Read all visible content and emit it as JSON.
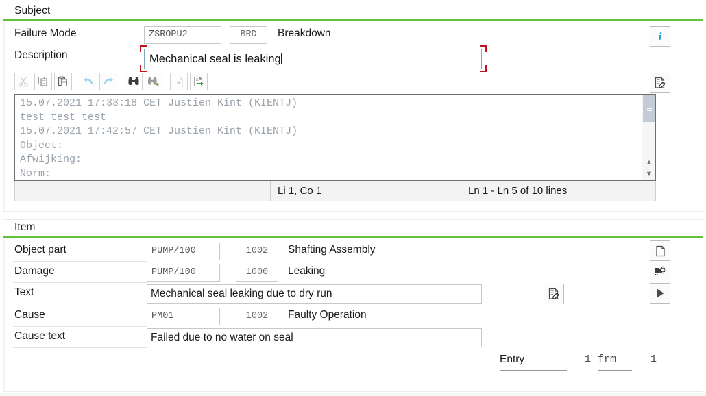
{
  "subject_section": {
    "title": "Subject",
    "failure_mode": {
      "label": "Failure Mode",
      "code": "ZSROPU2",
      "short_code": "BRD",
      "description": "Breakdown"
    },
    "description": {
      "label": "Description",
      "value": "Mechanical seal is leaking"
    },
    "toolbar": {
      "buttons": [
        {
          "name": "cut-icon",
          "title": "Cut",
          "enabled": false
        },
        {
          "name": "copy-icon",
          "title": "Copy",
          "enabled": true
        },
        {
          "name": "paste-icon",
          "title": "Paste",
          "enabled": true
        },
        {
          "name": "undo-icon",
          "title": "Undo",
          "enabled": true
        },
        {
          "name": "redo-icon",
          "title": "Redo",
          "enabled": true
        },
        {
          "name": "find-icon",
          "title": "Find",
          "enabled": true
        },
        {
          "name": "find-next-icon",
          "title": "Find Next",
          "enabled": true
        },
        {
          "name": "import-text-icon",
          "title": "Import Text",
          "enabled": false
        },
        {
          "name": "export-text-icon",
          "title": "Export Text",
          "enabled": true
        }
      ]
    },
    "long_text": "15.07.2021 17:33:18 CET Justien Kint (KIENTJ)\ntest test test\n15.07.2021 17:42:57 CET Justien Kint (KIENTJ)\nObject:\nAfwijking:\nNorm:",
    "status_bar": {
      "position": "Li 1, Co 1",
      "lines": "Ln 1 - Ln 5 of 10 lines"
    },
    "info_button_label": "i",
    "long_text_edit_button": "long-text-editor"
  },
  "item_section": {
    "title": "Item",
    "rows": [
      {
        "label": "Object part",
        "code": "PUMP/100",
        "num": "1002",
        "text": "Shafting Assembly"
      },
      {
        "label": "Damage",
        "code": "PUMP/100",
        "num": "1000",
        "text": "Leaking"
      },
      {
        "label": "Text",
        "value": "Mechanical seal leaking due to dry run"
      },
      {
        "label": "Cause",
        "code": "PM01",
        "num": "1002",
        "text": "Faulty Operation"
      },
      {
        "label": "Cause text",
        "value": "Failed due to no water on seal"
      }
    ],
    "side_buttons": [
      {
        "name": "new-document-icon",
        "title": "Create"
      },
      {
        "name": "object-components-icon",
        "title": "Object Components"
      },
      {
        "name": "execute-icon",
        "title": "Execute"
      }
    ],
    "text_edit_button": "item-long-text-editor",
    "footer": {
      "entry_label": "Entry",
      "entry_number": "1",
      "form_label": "frm",
      "form_number": "1"
    }
  },
  "colors": {
    "accent_green": "#63c23c",
    "marker_red": "#c1121f",
    "info_blue": "#1a9fd4",
    "field_text_gray": "#555555"
  }
}
